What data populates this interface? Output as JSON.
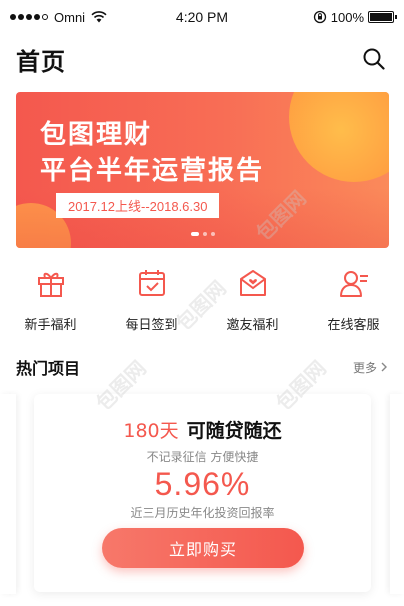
{
  "status_bar": {
    "carrier": "Omni",
    "time": "4:20 PM",
    "battery": "100%",
    "battery_level": 1.0
  },
  "header": {
    "title": "首页",
    "search_icon": "search-icon"
  },
  "banner": {
    "line1": "包图理财",
    "line2": "平台半年运营报告",
    "date_range": "2017.12上线--2018.6.30",
    "page_count": 3,
    "active_page": 0
  },
  "quick_menu": [
    {
      "label": "新手福利",
      "icon": "gift-icon"
    },
    {
      "label": "每日签到",
      "icon": "calendar-check-icon"
    },
    {
      "label": "邀友福利",
      "icon": "envelope-heart-icon"
    },
    {
      "label": "在线客服",
      "icon": "user-service-icon"
    }
  ],
  "section": {
    "title": "热门项目",
    "more": "更多"
  },
  "product": {
    "days": "180天",
    "name": "可随贷随还",
    "tags": "不记录征信 方便快捷",
    "rate": "5.96%",
    "rate_desc": "近三月历史年化投资回报率",
    "button": "立即购买"
  },
  "colors": {
    "accent": "#f4584e",
    "banner_gradient_end": "#fb8a5a",
    "deco_orange": "#ffc04a"
  },
  "watermark": "包图网"
}
